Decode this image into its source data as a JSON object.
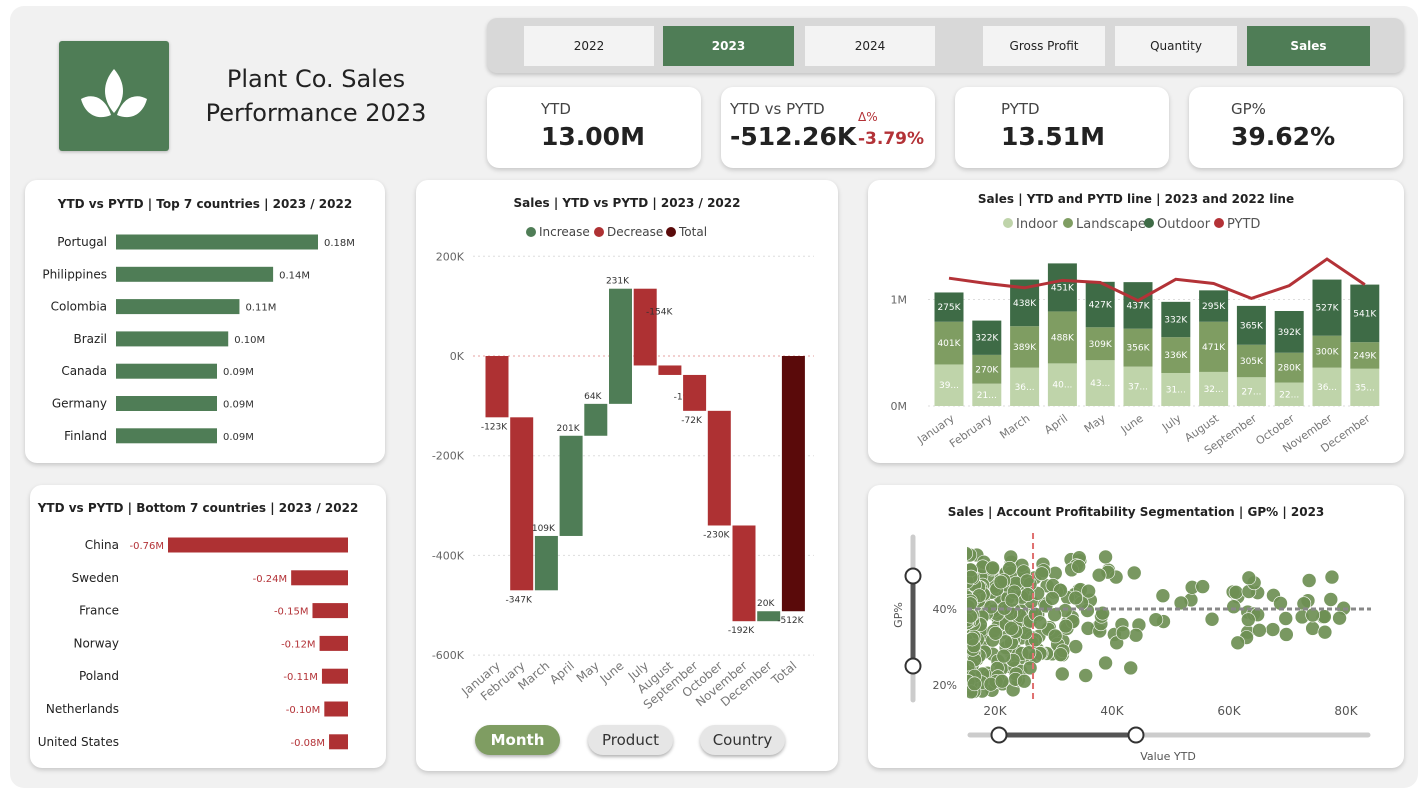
{
  "header": {
    "title_line1": "Plant Co. Sales",
    "title_line2": "Performance 2023"
  },
  "slicers": {
    "years": [
      {
        "label": "2022",
        "active": false
      },
      {
        "label": "2023",
        "active": true
      },
      {
        "label": "2024",
        "active": false
      }
    ],
    "measures": [
      {
        "label": "Gross Profit",
        "active": false
      },
      {
        "label": "Quantity",
        "active": false
      },
      {
        "label": "Sales",
        "active": true
      }
    ]
  },
  "kpis": {
    "ytd": {
      "label": "YTD",
      "value": "13.00M"
    },
    "ytd_vs_pytd": {
      "label": "YTD vs PYTD",
      "value": "-512.26K",
      "delta_label": "Δ%",
      "delta_value": "-3.79%"
    },
    "pytd": {
      "label": "PYTD",
      "value": "13.51M"
    },
    "gp": {
      "label": "GP%",
      "value": "39.62%"
    }
  },
  "colors": {
    "green": "#4f7d56",
    "red": "#ae3133",
    "darkred": "#5a0a0a",
    "indoor": "#bfd4aa",
    "landscape": "#7f9d62",
    "outdoor": "#3e6b46",
    "pytd": "#b33237",
    "scatter": "#6e8f54"
  },
  "chart_data": [
    {
      "type": "bar",
      "title": "YTD vs PYTD | Top 7 countries | 2023 / 2022",
      "categories": [
        "Portugal",
        "Philippines",
        "Colombia",
        "Brazil",
        "Canada",
        "Germany",
        "Finland"
      ],
      "values": [
        0.18,
        0.14,
        0.11,
        0.1,
        0.09,
        0.09,
        0.09
      ],
      "labels": [
        "0.18M",
        "0.14M",
        "0.11M",
        "0.10M",
        "0.09M",
        "0.09M",
        "0.09M"
      ]
    },
    {
      "type": "bar",
      "title": "YTD vs PYTD | Bottom 7 countries | 2023 / 2022",
      "categories": [
        "China",
        "Sweden",
        "France",
        "Norway",
        "Poland",
        "Netherlands",
        "United States"
      ],
      "values": [
        -0.76,
        -0.24,
        -0.15,
        -0.12,
        -0.11,
        -0.1,
        -0.08
      ],
      "labels": [
        "-0.76M",
        "-0.24M",
        "-0.15M",
        "-0.12M",
        "-0.11M",
        "-0.10M",
        "-0.08M"
      ]
    },
    {
      "type": "bar",
      "subtype": "waterfall",
      "title": "Sales |  YTD vs PYTD |  2023 / 2022",
      "legend": [
        "Increase",
        "Decrease",
        "Total"
      ],
      "categories": [
        "January",
        "February",
        "March",
        "April",
        "May",
        "June",
        "July",
        "August",
        "September",
        "October",
        "November",
        "December",
        "Total"
      ],
      "values": [
        -123,
        -347,
        109,
        201,
        64,
        231,
        -154,
        -19,
        -72,
        -230,
        -192,
        20,
        -512
      ],
      "labels": [
        "-123K",
        "-347K",
        "109K",
        "201K",
        "64K",
        "231K",
        "-154K",
        "-19K",
        "-72K",
        "-230K",
        "-192K",
        "20K",
        "-512K"
      ],
      "y_ticks": [
        "200K",
        "0K",
        "-200K",
        "-400K",
        "-600K"
      ],
      "ylim": [
        -600,
        200
      ],
      "unit": "K"
    },
    {
      "type": "bar",
      "subtype": "stacked-with-line",
      "title": "Sales | YTD and PYTD line | 2023 and 2022 line",
      "legend": [
        "Indoor",
        "Landscape",
        "Outdoor",
        "PYTD"
      ],
      "categories": [
        "January",
        "February",
        "March",
        "April",
        "May",
        "June",
        "July",
        "August",
        "September",
        "October",
        "November",
        "December"
      ],
      "series": [
        {
          "name": "Indoor",
          "values": [
            390,
            210,
            360,
            400,
            430,
            370,
            310,
            320,
            270,
            220,
            360,
            350
          ],
          "labels": [
            "39...",
            "21...",
            "36...",
            "40...",
            "43...",
            "37...",
            "31...",
            "32...",
            "27...",
            "22...",
            "36...",
            "35..."
          ]
        },
        {
          "name": "Landscape",
          "values": [
            401,
            270,
            389,
            488,
            309,
            356,
            336,
            471,
            305,
            280,
            300,
            249
          ],
          "labels": [
            "401K",
            "270K",
            "389K",
            "488K",
            "309K",
            "356K",
            "336K",
            "471K",
            "305K",
            "280K",
            "300K",
            "249K"
          ]
        },
        {
          "name": "Outdoor",
          "values": [
            275,
            322,
            438,
            451,
            427,
            437,
            332,
            295,
            365,
            392,
            527,
            541
          ],
          "labels": [
            "275K",
            "322K",
            "438K",
            "451K",
            "427K",
            "437K",
            "332K",
            "295K",
            "365K",
            "392K",
            "527K",
            "541K"
          ]
        },
        {
          "name": "PYTD",
          "type": "line",
          "values": [
            1200,
            1150,
            1110,
            1180,
            1160,
            990,
            1190,
            1150,
            1010,
            1130,
            1380,
            1140
          ]
        }
      ],
      "y_ticks": [
        "1M",
        "0M"
      ],
      "ylim": [
        0,
        1800
      ],
      "unit": "K"
    },
    {
      "type": "scatter",
      "title": "Sales | Account Profitability Segmentation | GP% | 2023",
      "xlabel": "Value YTD",
      "ylabel": "GP%",
      "x_ticks": [
        "20K",
        "40K",
        "60K",
        "80K"
      ],
      "y_ticks": [
        "40%",
        "20%"
      ],
      "xlim": [
        15,
        82
      ],
      "ylim": [
        17,
        55
      ],
      "avg_x": 26.5,
      "avg_y": 40
    }
  ],
  "scatter_points": [
    [
      33,
      53
    ],
    [
      39.4,
      50.2
    ],
    [
      40.7,
      48.4
    ],
    [
      53.5,
      42.4
    ],
    [
      57.1,
      37.3
    ],
    [
      36.3,
      42.3
    ],
    [
      39.3,
      49.7
    ],
    [
      43.8,
      49.5
    ],
    [
      22.8,
      52.3
    ],
    [
      15.4,
      40.3
    ],
    [
      40.4,
      33.3
    ],
    [
      44.6,
      35.8
    ],
    [
      20.6,
      45.1
    ],
    [
      20.1,
      38.3
    ],
    [
      17.3,
      45.8
    ],
    [
      34.3,
      44.9
    ],
    [
      33,
      36.3
    ],
    [
      34.5,
      52.7
    ],
    [
      51.8,
      41.6
    ],
    [
      41.7,
      35.9
    ],
    [
      20.7,
      48.5
    ],
    [
      61.5,
      43.2
    ],
    [
      37.5,
      35
    ],
    [
      53.7,
      45.7
    ],
    [
      23.2,
      29.8
    ],
    [
      33.6,
      43.8
    ],
    [
      21.8,
      49.1
    ],
    [
      30.1,
      44.4
    ],
    [
      17.1,
      46
    ],
    [
      37.8,
      48.9
    ],
    [
      23.5,
      43.7
    ],
    [
      28.2,
      51.8
    ],
    [
      24.5,
      32.4
    ],
    [
      19.5,
      18.6
    ],
    [
      26.1,
      37.6
    ],
    [
      27.3,
      38.5
    ],
    [
      19.6,
      28.1
    ],
    [
      21.1,
      41.6
    ],
    [
      40.8,
      31.1
    ],
    [
      22.7,
      28.6
    ],
    [
      34.4,
      53.5
    ],
    [
      20.8,
      35.6
    ],
    [
      20.6,
      37.3
    ],
    [
      34.6,
      45.1
    ],
    [
      29.8,
      28.2
    ],
    [
      21.8,
      43.5
    ],
    [
      55.5,
      45.9
    ],
    [
      26.8,
      48.2
    ],
    [
      35.8,
      39.6
    ],
    [
      31,
      29.8
    ],
    [
      35.9,
      34.9
    ],
    [
      17.9,
      31.6
    ],
    [
      44.1,
      33.1
    ],
    [
      29.3,
      35.1
    ],
    [
      25.9,
      27
    ],
    [
      41.9,
      33.7
    ],
    [
      23,
      30.9
    ],
    [
      31.5,
      22.9
    ],
    [
      18.7,
      23.1
    ],
    [
      30.3,
      49.4
    ],
    [
      19.9,
      44.6
    ],
    [
      21,
      42.9
    ],
    [
      16.2,
      23.4
    ],
    [
      22.6,
      29.2
    ],
    [
      25.1,
      35.2
    ],
    [
      32.4,
      36.4
    ],
    [
      33.9,
      51.4
    ],
    [
      23.9,
      35
    ],
    [
      33.2,
      37.8
    ],
    [
      18.1,
      30
    ],
    [
      38.9,
      53.7
    ],
    [
      48.7,
      43.5
    ],
    [
      37.9,
      34.2
    ],
    [
      16.9,
      54.2
    ],
    [
      15.5,
      43.5
    ],
    [
      24.3,
      40.1
    ],
    [
      48.8,
      36.7
    ],
    [
      17.4,
      45.2
    ],
    [
      32.4,
      43
    ],
    [
      24.2,
      43.5
    ],
    [
      18.4,
      40.4
    ],
    [
      26.2,
      39.3
    ],
    [
      34.8,
      41.6
    ],
    [
      20.4,
      39.5
    ],
    [
      24.7,
      44.8
    ],
    [
      21,
      36.4
    ],
    [
      24.5,
      39.5
    ],
    [
      33.8,
      42.9
    ],
    [
      33.1,
      50.3
    ],
    [
      30.4,
      32.6
    ],
    [
      31.6,
      31.6
    ],
    [
      19.4,
      44.4
    ],
    [
      22.4,
      24.9
    ],
    [
      26.2,
      41.9
    ],
    [
      21.3,
      20.3
    ],
    [
      27.3,
      29.3
    ],
    [
      21.7,
      33.9
    ],
    [
      24.7,
      44.3
    ],
    [
      16.4,
      43.9
    ],
    [
      24.1,
      38.5
    ],
    [
      35.5,
      22.5
    ],
    [
      24.8,
      48.9
    ],
    [
      19.8,
      39.5
    ],
    [
      23.1,
      18.7
    ],
    [
      23.6,
      29
    ],
    [
      38.1,
      36.1
    ],
    [
      34.3,
      51.2
    ],
    [
      24.6,
      51.5
    ],
    [
      25.6,
      36.5
    ],
    [
      16.2,
      33.2
    ],
    [
      31,
      45.1
    ],
    [
      47.5,
      37.2
    ],
    [
      30.7,
      30.7
    ],
    [
      22.7,
      53.7
    ],
    [
      22.2,
      42.9
    ],
    [
      30.5,
      44.6
    ],
    [
      32.3,
      34.9
    ],
    [
      33.8,
      30.1
    ],
    [
      15.5,
      25.5
    ],
    [
      28.3,
      50.1
    ],
    [
      23.2,
      32.1
    ],
    [
      23.3,
      39.6
    ],
    [
      36,
      44.7
    ],
    [
      15.9,
      46.3
    ],
    [
      27.5,
      32.8
    ],
    [
      28.5,
      41.3
    ],
    [
      20.5,
      35.4
    ],
    [
      22.8,
      38.9
    ],
    [
      26.3,
      32.4
    ],
    [
      18.3,
      49.8
    ],
    [
      23.6,
      46.8
    ],
    [
      15.7,
      54.2
    ],
    [
      21.9,
      49.5
    ],
    [
      15.5,
      49.5
    ],
    [
      31.5,
      27.9
    ],
    [
      19.5,
      50.9
    ],
    [
      23.5,
      35.6
    ],
    [
      29.1,
      34.7
    ],
    [
      20,
      46
    ],
    [
      18.2,
      28.7
    ],
    [
      20.5,
      26.3
    ],
    [
      28.7,
      40.8
    ],
    [
      26.3,
      31.1
    ],
    [
      16,
      32.4
    ],
    [
      17.9,
      33.5
    ],
    [
      21.9,
      36.1
    ],
    [
      28.8,
      28.3
    ],
    [
      33.3,
      36.7
    ],
    [
      31.6,
      29
    ],
    [
      26.9,
      31.9
    ],
    [
      18,
      42.1
    ],
    [
      21.9,
      29.8
    ],
    [
      24.6,
      43.1
    ],
    [
      28.9,
      46.1
    ],
    [
      43.2,
      24.5
    ],
    [
      22.7,
      49.5
    ],
    [
      21.1,
      24.3
    ],
    [
      20.4,
      21.9
    ],
    [
      38.2,
      38.1
    ],
    [
      24.3,
      38.3
    ],
    [
      25.2,
      33.7
    ],
    [
      22.2,
      39.8
    ],
    [
      17.3,
      47.3
    ],
    [
      24,
      21.3
    ],
    [
      28,
      49.3
    ],
    [
      18.7,
      48.7
    ],
    [
      26,
      36.8
    ],
    [
      24,
      26.7
    ],
    [
      23.4,
      24.5
    ],
    [
      32,
      39.6
    ],
    [
      18.1,
      52.3
    ],
    [
      32.1,
      35.5
    ],
    [
      24.6,
      28.3
    ],
    [
      22.5,
      50.7
    ],
    [
      27.3,
      44.1
    ],
    [
      30.2,
      38.5
    ],
    [
      27.9,
      28.3
    ],
    [
      29.9,
      46.2
    ],
    [
      22.8,
      31.1
    ],
    [
      31.2,
      44.9
    ],
    [
      30.3,
      32.9
    ],
    [
      38.4,
      38.9
    ],
    [
      31.2,
      28
    ],
    [
      17.2,
      42.2
    ],
    [
      17.6,
      48.6
    ],
    [
      24.4,
      23.6
    ],
    [
      22.7,
      38.8
    ],
    [
      17.1,
      27.8
    ],
    [
      29.8,
      42.8
    ],
    [
      26.9,
      38.6
    ],
    [
      21.9,
      46.3
    ],
    [
      19.1,
      22.3
    ],
    [
      23.6,
      46.8
    ],
    [
      20.4,
      24.4
    ],
    [
      38.9,
      25.8
    ],
    [
      23.1,
      26.5
    ],
    [
      17.9,
      22.9
    ],
    [
      23.6,
      22.9
    ],
    [
      20.4,
      38.6
    ],
    [
      20.5,
      22.2
    ],
    [
      17.9,
      46.3
    ],
    [
      26,
      46.5
    ],
    [
      15.9,
      37.9
    ],
    [
      23.5,
      21.5
    ],
    [
      21.8,
      31.4
    ],
    [
      18.6,
      38.9
    ],
    [
      25,
      21
    ],
    [
      20.3,
      45.2
    ],
    [
      27.7,
      28.3
    ],
    [
      26.9,
      27.5
    ],
    [
      17.5,
      45.6
    ],
    [
      21.6,
      40.2
    ],
    [
      20.2,
      20.9
    ],
    [
      24.9,
      49.8
    ],
    [
      27.7,
      36.4
    ],
    [
      26,
      24.5
    ],
    [
      16.9,
      26.8
    ],
    [
      19.3,
      40.5
    ],
    [
      25.5,
      47.4
    ],
    [
      17.6,
      34.5
    ],
    [
      25.6,
      43.8
    ],
    [
      25.8,
      28.5
    ],
    [
      19.5,
      50.5
    ],
    [
      23.5,
      34.1
    ],
    [
      23.3,
      44.5
    ],
    [
      15.5,
      30.1
    ],
    [
      17.3,
      27.7
    ],
    [
      22.9,
      42.3
    ],
    [
      15.6,
      40.3
    ],
    [
      19.6,
      31.8
    ],
    [
      15.3,
      20.5
    ],
    [
      17.9,
      51.1
    ],
    [
      16.2,
      33.2
    ],
    [
      21.5,
      47.5
    ],
    [
      21,
      47.1
    ],
    [
      17.8,
      37.9
    ],
    [
      19.8,
      34.2
    ],
    [
      21.5,
      27.6
    ],
    [
      19.6,
      50.8
    ],
    [
      17.8,
      18.4
    ],
    [
      16.2,
      18.9
    ],
    [
      17.5,
      35.9
    ],
    [
      17.7,
      20.6
    ],
    [
      18,
      43.9
    ],
    [
      19.3,
      20.2
    ],
    [
      21.2,
      21
    ],
    [
      15.5,
      28.5
    ],
    [
      20.1,
      33.6
    ],
    [
      16.4,
      28.4
    ],
    [
      22.8,
      34.9
    ],
    [
      17,
      32
    ],
    [
      16.1,
      25.2
    ],
    [
      15.7,
      37.2
    ],
    [
      16.3,
      36
    ],
    [
      16.4,
      32.6
    ],
    [
      15.9,
      47.5
    ],
    [
      16.3,
      43.4
    ],
    [
      15.6,
      24.4
    ],
    [
      15.5,
      18.9
    ],
    [
      15.5,
      47
    ],
    [
      16.3,
      42.5
    ],
    [
      16.5,
      26.6
    ],
    [
      15.4,
      46.4
    ],
    [
      16.2,
      37.1
    ],
    [
      17.2,
      45.8
    ],
    [
      16.2,
      29.4
    ],
    [
      15.1,
      43.2
    ],
    [
      15.5,
      36.6
    ],
    [
      16.4,
      18.3
    ],
    [
      16.5,
      46.3
    ],
    [
      17.3,
      43.5
    ],
    [
      16.2,
      48.2
    ],
    [
      15.8,
      50.2
    ],
    [
      16.1,
      38.5
    ],
    [
      15.1,
      31.8
    ],
    [
      15.8,
      42.1
    ],
    [
      15.4,
      24.7
    ],
    [
      16.4,
      30.3
    ],
    [
      15.6,
      40.6
    ],
    [
      15.2,
      47.2
    ],
    [
      15.9,
      20.2
    ],
    [
      15,
      54.6
    ],
    [
      15.2,
      36.4
    ],
    [
      15.6,
      21.9
    ],
    [
      15.4,
      40.6
    ],
    [
      16.5,
      22.3
    ],
    [
      15.8,
      41.4
    ],
    [
      15.4,
      20.9
    ],
    [
      15.9,
      18.2
    ],
    [
      15.8,
      50.3
    ],
    [
      16.5,
      20.3
    ],
    [
      16.1,
      32.1
    ],
    [
      15.2,
      37.1
    ],
    [
      15.9,
      48.4
    ],
    [
      15.8,
      38.1
    ],
    [
      63.2,
      33.9
    ],
    [
      60.7,
      44.5
    ],
    [
      63.2,
      39.2
    ],
    [
      64.9,
      44.3
    ],
    [
      73.5,
      42.2
    ],
    [
      61.2,
      44.4
    ],
    [
      67.6,
      43.6
    ],
    [
      60.8,
      40.6
    ],
    [
      77.6,
      48.4
    ],
    [
      72.8,
      41.4
    ],
    [
      63,
      32.5
    ],
    [
      63.4,
      44.6
    ],
    [
      76.1,
      37.9
    ],
    [
      73.7,
      47.5
    ],
    [
      64.2,
      38.7
    ],
    [
      79.6,
      40.2
    ],
    [
      68.8,
      41.5
    ],
    [
      78.9,
      37.6
    ],
    [
      64.3,
      46.9
    ],
    [
      67.5,
      34.6
    ],
    [
      72.5,
      37.9
    ],
    [
      76.3,
      38
    ],
    [
      74.3,
      34.9
    ],
    [
      69.7,
      37.5
    ],
    [
      65.2,
      34.4
    ],
    [
      61.5,
      31.1
    ],
    [
      74.3,
      38.4
    ],
    [
      77.4,
      42.5
    ],
    [
      76.4,
      33.9
    ],
    [
      64.9,
      38.5
    ],
    [
      63.3,
      37.2
    ],
    [
      69.8,
      33.3
    ],
    [
      63.4,
      48.2
    ]
  ]
}
